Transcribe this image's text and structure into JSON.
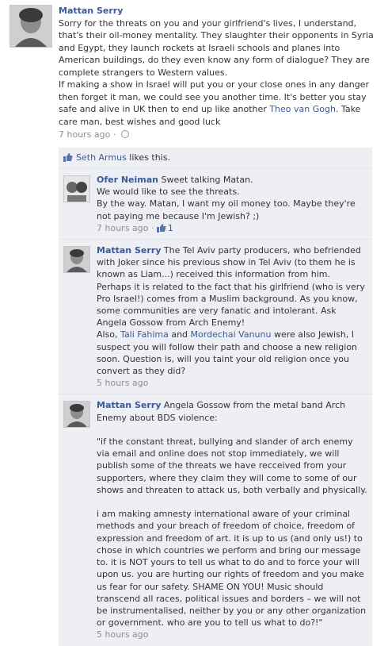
{
  "post": {
    "author": "Mattan Serry",
    "text_before_link": "Sorry for the threats on you and your girlfriend's lives, I understand, that's their oil-money mentality. They slaughter their opponents in Syria and Egypt, they launch rockets at Israeli schools and planes into American buildings, do they even know any form of dialogue? They are complete strangers to Western values.\nIf making a show in Israel will put you or your close ones in any danger then forget it man, we could see you another time. It's better you stay safe and alive in UK then to end up like another ",
    "link_text": "Theo van Gogh",
    "text_after_link": ". Take care man, best wishes and good luck",
    "time": "7 hours ago",
    "separator": " · "
  },
  "likes": {
    "liker": "Seth Armus",
    "suffix": " likes this."
  },
  "comments": [
    {
      "author": "Ofer Neiman",
      "text": " Sweet talking Matan.\nWe would like to see the threats.\nBy the way. Matan, I want my oil money too. Maybe they're not paying me because I'm Jewish? ;)",
      "time": "7 hours ago",
      "separator": " · ",
      "like_count": "1"
    },
    {
      "author": "Mattan Serry",
      "text_a": " The Tel Aviv party producers, who befriended with Joker since his previous show in Tel Aviv (to them he is known as Liam...) received this information from him. Perhaps it is related to the fact that his girlfriend (who is very Pro Israel!) comes from a Muslim background. As you know, some communities are very fanatic and intolerant. Ask Angela Gossow from Arch Enemy!\nAlso, ",
      "link1": "Tali Fahima",
      "text_b": " and ",
      "link2": "Mordechai Vanunu",
      "text_c": " were also Jewish, I suspect you will follow their path and choose a new religion soon. Question is, will you taint your old religion once you convert as they did?",
      "time": "5 hours ago"
    },
    {
      "author": "Mattan Serry",
      "text": " Angela Gossow from the metal band Arch Enemy about BDS violence:\n\n\"if the constant threat, bullying and slander of arch enemy via email and online does not stop immediately, we will publish some of the threats we have recceived from your supporters, where they claim they will come to some of our shows and threaten to attack us, both verbally and physically.\n\ni am making amnesty international aware of your criminal methods and your breach of freedom of choice, freedom of expression and freedom of art. it is up to us (and only us!) to chose in which countries we perform and bring our message to. it is NOT yours to tell us what to do and to force your will upon us. you are hurting our rights of freedom and you make us fear for our safety. SHAME ON YOU! Music should transcend all races, political issues and borders – we will not be instrumentalised, neither by you or any other organization or government. who are you to tell us what to do?!\"",
      "time": "5 hours ago"
    }
  ],
  "colors": {
    "link": "#3b5998",
    "meta": "#8e8e8e",
    "feedback_bg": "#edeff4"
  },
  "icons": [
    "profile-photo",
    "globe-icon",
    "thumbs-up-icon"
  ]
}
